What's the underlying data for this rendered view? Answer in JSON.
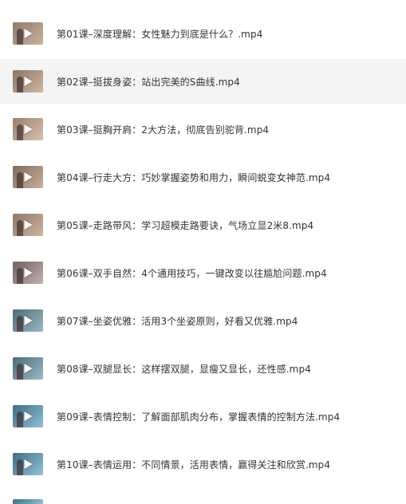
{
  "lessons": [
    {
      "title": "第01课–深度理解：女性魅力到底是什么？.mp4",
      "colors": [
        "#8e7a6a",
        "#c9b39c"
      ],
      "highlighted": false,
      "thumbnail_icon": "play-icon"
    },
    {
      "title": "第02课–挺拔身姿：站出完美的S曲线.mp4",
      "colors": [
        "#8a7463",
        "#d0b9a2"
      ],
      "highlighted": true,
      "thumbnail_icon": "play-icon"
    },
    {
      "title": "第03课–挺胸开肩：2大方法，彻底告别驼背.mp4",
      "colors": [
        "#9a7f6a",
        "#d6c2ae"
      ],
      "highlighted": false,
      "thumbnail_icon": "play-icon"
    },
    {
      "title": "第04课–行走大方：巧妙掌握姿势和用力，瞬间蜕变女神范.mp4",
      "colors": [
        "#7f6a5c",
        "#c8b19b"
      ],
      "highlighted": false,
      "thumbnail_icon": "play-icon"
    },
    {
      "title": "第05课–走路带风：学习超模走路要诀，气场立显2米8.mp4",
      "colors": [
        "#8d7866",
        "#cdb6a0"
      ],
      "highlighted": false,
      "thumbnail_icon": "play-icon"
    },
    {
      "title": "第06课–双手自然：4个通用技巧，一键改变以往尴尬问题.mp4",
      "colors": [
        "#6e5f62",
        "#c3b2b0"
      ],
      "highlighted": false,
      "thumbnail_icon": "play-icon"
    },
    {
      "title": "第07课–坐姿优雅：活用3个坐姿原则，好看又优雅.mp4",
      "colors": [
        "#4f6b78",
        "#9ab8c3"
      ],
      "highlighted": false,
      "thumbnail_icon": "play-icon"
    },
    {
      "title": "第08课–双腿显长：这样摆双腿，显瘦又显长，还性感.mp4",
      "colors": [
        "#4d6a77",
        "#9bbac6"
      ],
      "highlighted": false,
      "thumbnail_icon": "play-icon"
    },
    {
      "title": "第09课–表情控制：了解面部肌肉分布，掌握表情的控制方法.mp4",
      "colors": [
        "#3f6d85",
        "#8fc0d6"
      ],
      "highlighted": false,
      "thumbnail_icon": "play-icon"
    },
    {
      "title": "第10课–表情运用：不同情景，活用表情，赢得关注和欣赏.mp4",
      "colors": [
        "#3d6c86",
        "#93c3d8"
      ],
      "highlighted": false,
      "thumbnail_icon": "play-icon"
    }
  ],
  "colors": {
    "highlight_background": "#f4f4f5",
    "text": "#333333"
  }
}
